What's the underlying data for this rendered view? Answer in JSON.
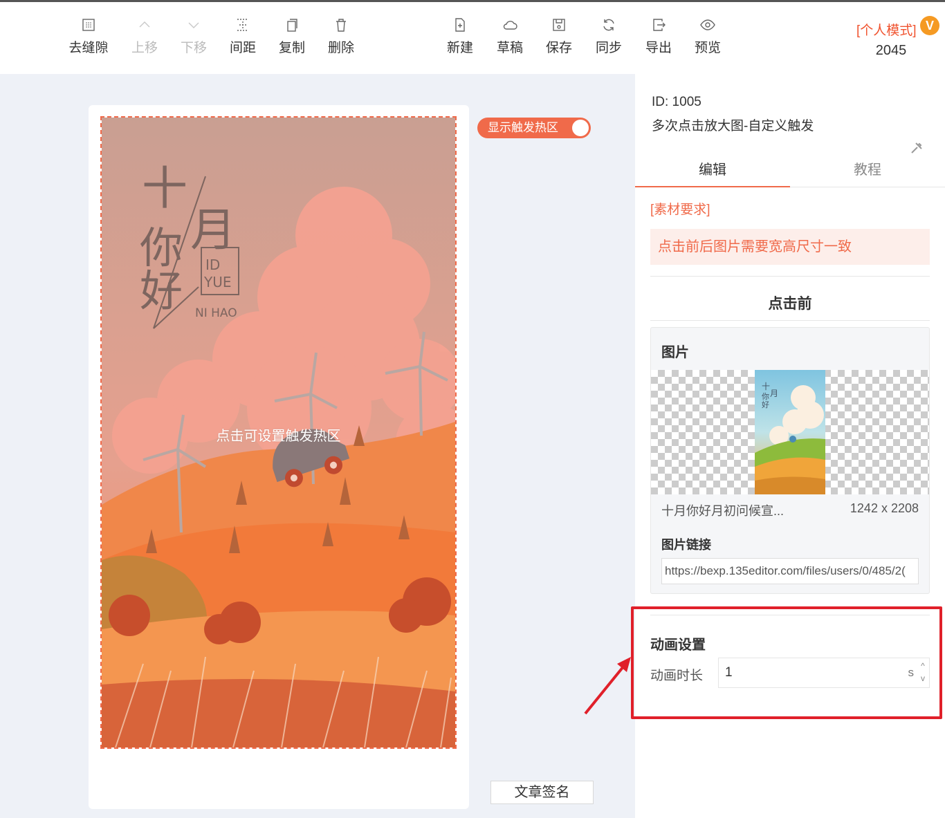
{
  "toolbar": {
    "buttons": [
      {
        "label": "去缝隙",
        "icon": "grid-dots-icon",
        "disabled": false
      },
      {
        "label": "上移",
        "icon": "chevron-up-icon",
        "disabled": true
      },
      {
        "label": "下移",
        "icon": "chevron-down-icon",
        "disabled": true
      },
      {
        "label": "间距",
        "icon": "spacing-icon",
        "disabled": false
      },
      {
        "label": "复制",
        "icon": "copy-icon",
        "disabled": false
      },
      {
        "label": "删除",
        "icon": "trash-icon",
        "disabled": false
      },
      {
        "label": "新建",
        "icon": "new-file-icon",
        "disabled": false
      },
      {
        "label": "草稿",
        "icon": "cloud-icon",
        "disabled": false
      },
      {
        "label": "保存",
        "icon": "save-icon",
        "disabled": false
      },
      {
        "label": "同步",
        "icon": "sync-icon",
        "disabled": false
      },
      {
        "label": "导出",
        "icon": "export-icon",
        "disabled": false
      },
      {
        "label": "预览",
        "icon": "eye-icon",
        "disabled": false
      }
    ],
    "mode_label": "[个人模式]",
    "mode_badge": "V",
    "mode_count": "2045"
  },
  "canvas": {
    "hint": "点击可设置触发热区",
    "toggle_label": "显示触发热区",
    "sign_button": "文章签名",
    "poster_text": {
      "shi": "十",
      "yue": "月",
      "ni": "你",
      "hao": "好",
      "id": "ID",
      "yue_en": "YUE",
      "nihao_en": "NI HAO"
    }
  },
  "panel": {
    "id_line": "ID: 1005",
    "name": "多次点击放大图-自定义触发",
    "tabs": [
      "编辑",
      "教程"
    ],
    "requirement_title": "[素材要求]",
    "requirement_text": "点击前后图片需要宽高尺寸一致",
    "section_title": "点击前",
    "image_card": {
      "title": "图片",
      "file_name": "十月你好月初问候宣...",
      "dimensions": "1242 x 2208",
      "link_label": "图片链接",
      "link_value": "https://bexp.135editor.com/files/users/0/485/2("
    },
    "animation": {
      "title": "动画设置",
      "duration_label": "动画时长",
      "duration_value": "1",
      "unit": "s",
      "step_up": "^",
      "step_down": "v"
    }
  },
  "colors": {
    "accent": "#f06a4a",
    "annotation_red": "#e0202a",
    "badge": "#f59a23"
  }
}
